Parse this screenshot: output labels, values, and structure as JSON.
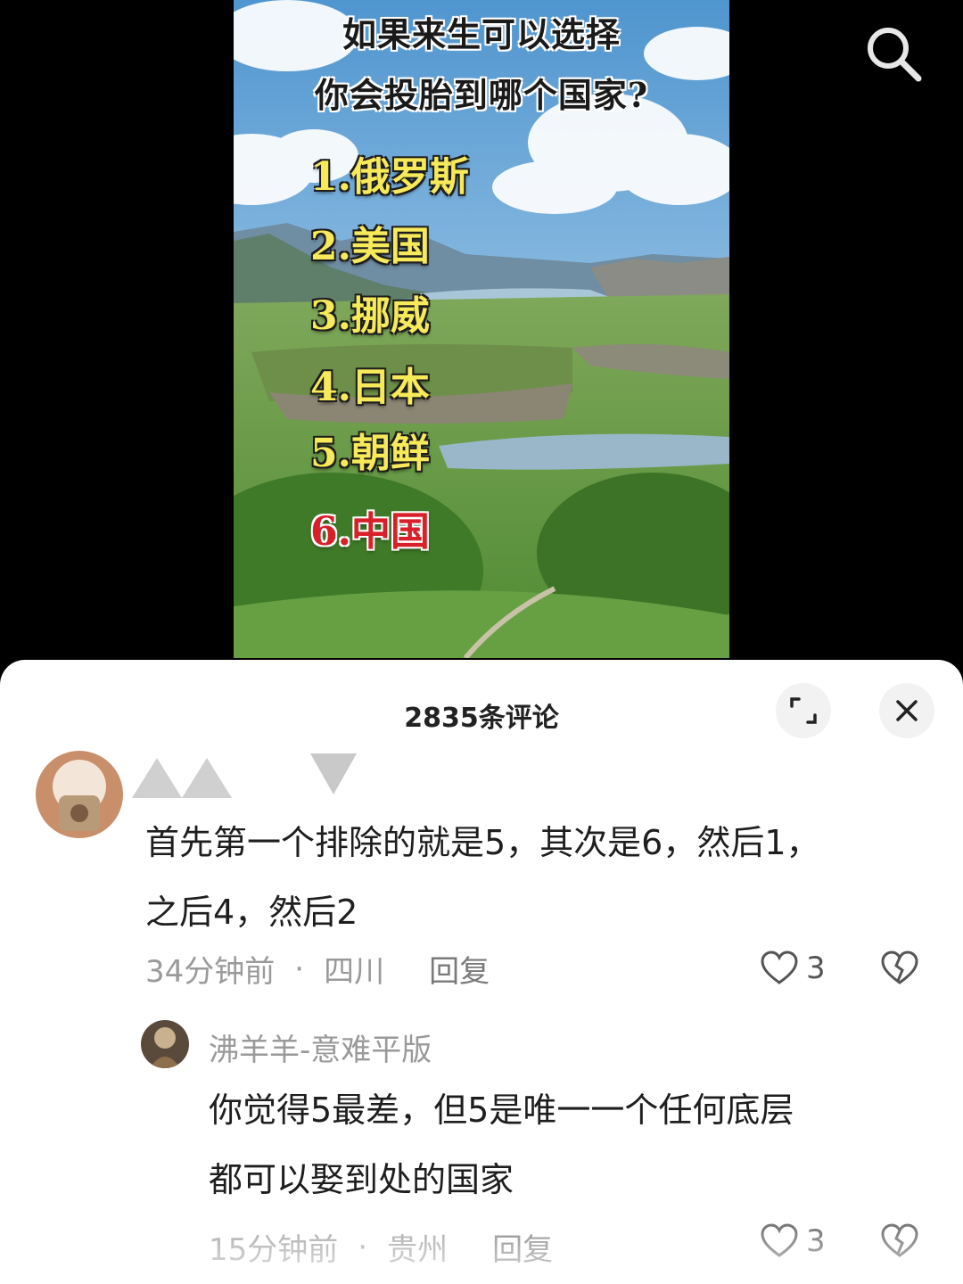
{
  "poster": {
    "title_line1": "如果来生可以选择",
    "title_line2": "你会投胎到哪个国家?",
    "options": [
      "1.俄罗斯",
      "2.美国",
      "3.挪威",
      "4.日本",
      "5.朝鲜",
      "6.中国"
    ]
  },
  "header_icons": {
    "search": "search-icon"
  },
  "comments_panel": {
    "title": "2835条评论",
    "expand_icon": "expand-icon",
    "close_icon": "close-icon",
    "comments": [
      {
        "text_line1": "首先第一个排除的就是5，其次是6，然后1，",
        "text_line2": "之后4，然后2",
        "time": "34分钟前",
        "location": "四川",
        "reply_label": "回复",
        "likes": "3"
      }
    ],
    "reply": {
      "username": "沸羊羊-意难平版",
      "text_line1": "你觉得5最差，但5是唯一一个任何底层",
      "text_line2": "都可以娶到处的国家",
      "time": "15分钟前",
      "location": "贵州",
      "reply_label": "回复",
      "likes": "3"
    }
  }
}
